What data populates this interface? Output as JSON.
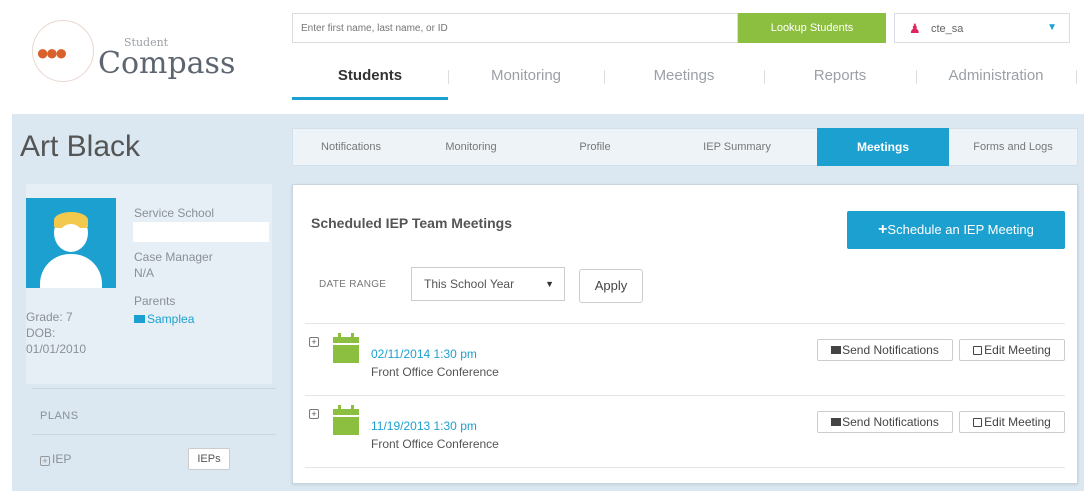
{
  "header": {
    "logo_small": "Student",
    "logo_big": "Compass",
    "search_placeholder": "Enter first name, last name, or ID",
    "lookup_label": "Lookup Students",
    "user": "cte_sa"
  },
  "main_nav": [
    {
      "label": "Students",
      "active": true
    },
    {
      "label": "Monitoring",
      "active": false
    },
    {
      "label": "Meetings",
      "active": false
    },
    {
      "label": "Reports",
      "active": false
    },
    {
      "label": "Administration",
      "active": false
    }
  ],
  "student": {
    "name": "Art Black",
    "service_school_label": "Service School",
    "case_manager_label": "Case Manager",
    "case_manager": "N/A",
    "parents_label": "Parents",
    "parent": "Samplea",
    "grade": "Grade: 7",
    "dob_label": "DOB:",
    "dob": "01/01/2010"
  },
  "plans": {
    "label": "PLANS",
    "iep_label": "IEP",
    "ieps_button": "IEPs"
  },
  "sub_nav": [
    {
      "label": "Notifications",
      "active": false
    },
    {
      "label": "Monitoring",
      "active": false
    },
    {
      "label": "Profile",
      "active": false
    },
    {
      "label": "IEP Summary",
      "active": false
    },
    {
      "label": "Meetings",
      "active": true
    },
    {
      "label": "Forms and Logs",
      "active": false
    }
  ],
  "meetings_panel": {
    "title": "Scheduled IEP Team Meetings",
    "schedule_label": "Schedule an IEP Meeting",
    "date_range_label": "DATE RANGE",
    "date_range_value": "This School Year",
    "apply_label": "Apply",
    "send_label": "Send Notifications",
    "edit_label": "Edit Meeting",
    "meetings": [
      {
        "date": "02/11/2014 1:30 pm",
        "place": "Front Office Conference"
      },
      {
        "date": "11/19/2013 1:30 pm",
        "place": "Front Office Conference"
      }
    ]
  },
  "colors": {
    "accent": "#1ca0d0",
    "green": "#8cbf3f",
    "panel_bg": "#dbe8f1"
  }
}
